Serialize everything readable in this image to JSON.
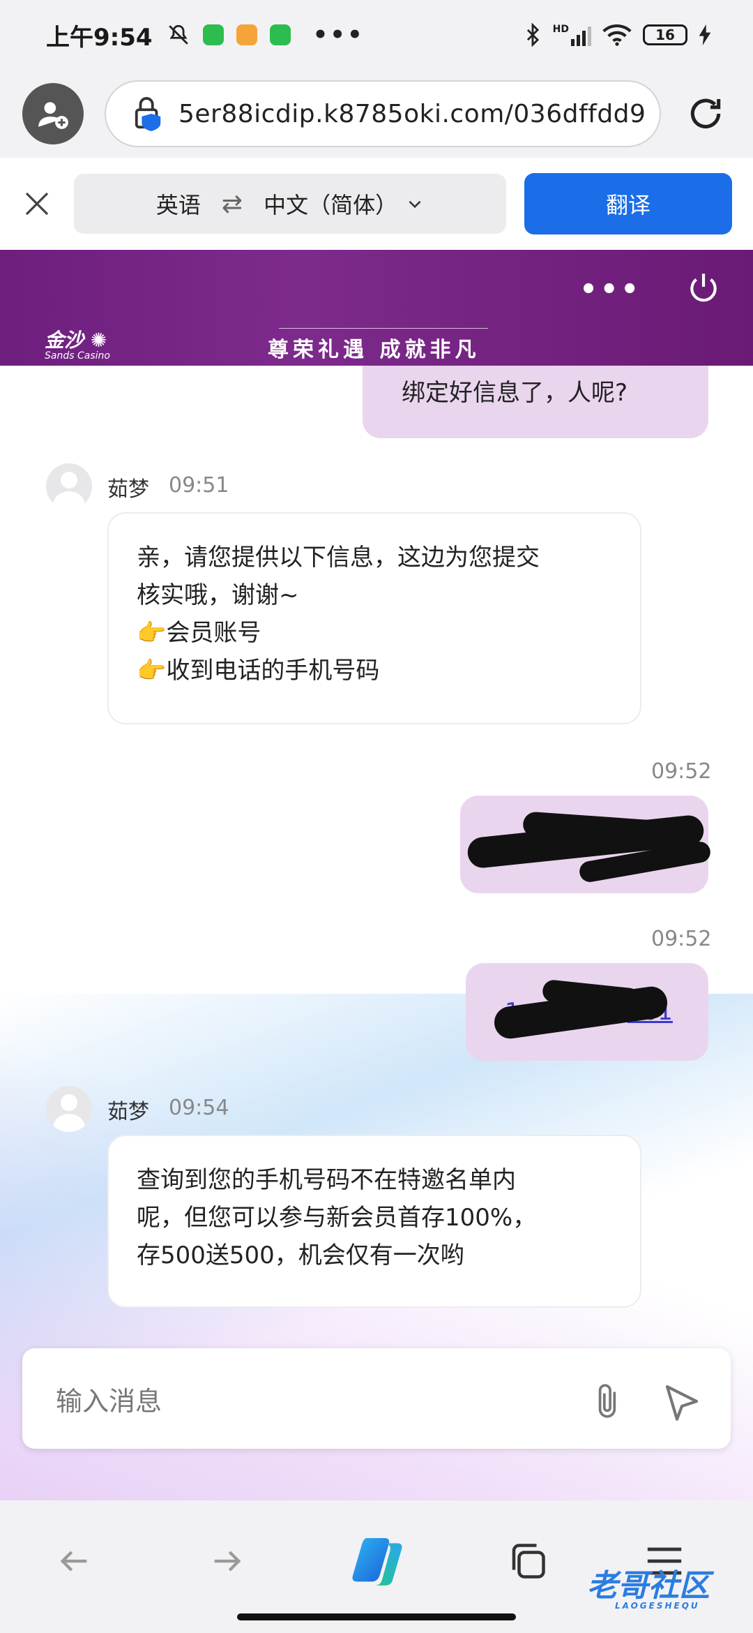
{
  "status_bar": {
    "time": "上午9:54",
    "battery": "16",
    "network": "HD"
  },
  "browser": {
    "url": "5er88icdip.k8785oki.com/036dffdd9"
  },
  "translate_bar": {
    "source_lang": "英语",
    "swap_symbol": "⇄",
    "target_lang": "中文（简体）",
    "translate_button": "翻译"
  },
  "banner": {
    "logo_text": "金沙",
    "logo_sub": "Sands Casino",
    "slogan": "尊荣礼遇  成就非凡"
  },
  "chat": {
    "messages": [
      {
        "from": "me",
        "text": "绑定好信息了，人呢?"
      },
      {
        "from": "agent",
        "sender": "茹梦",
        "time": "09:51",
        "lines": [
          "亲，请您提供以下信息，这边为您提交",
          "核实哦，谢谢~",
          "👉会员账号",
          "👉收到电话的手机号码"
        ]
      },
      {
        "from": "me",
        "time": "09:52",
        "redacted": true
      },
      {
        "from": "me",
        "time": "09:52",
        "redacted": true,
        "link_fragment_start": "1",
        "link_fragment_end": "561"
      },
      {
        "from": "agent",
        "sender": "茹梦",
        "time": "09:54",
        "lines": [
          "查询到您的手机号码不在特邀名单内",
          "呢，但您可以参与新会员首存100%，",
          "存500送500，机会仅有一次哟"
        ]
      }
    ]
  },
  "input": {
    "placeholder": "输入消息"
  },
  "watermark": {
    "text": "老哥社区",
    "sub": "LAOGESHEQU"
  },
  "colors": {
    "accent_blue": "#1b6ee8",
    "banner_purple": "#7d2a8c",
    "outgoing_bubble": "#ead5ee"
  }
}
